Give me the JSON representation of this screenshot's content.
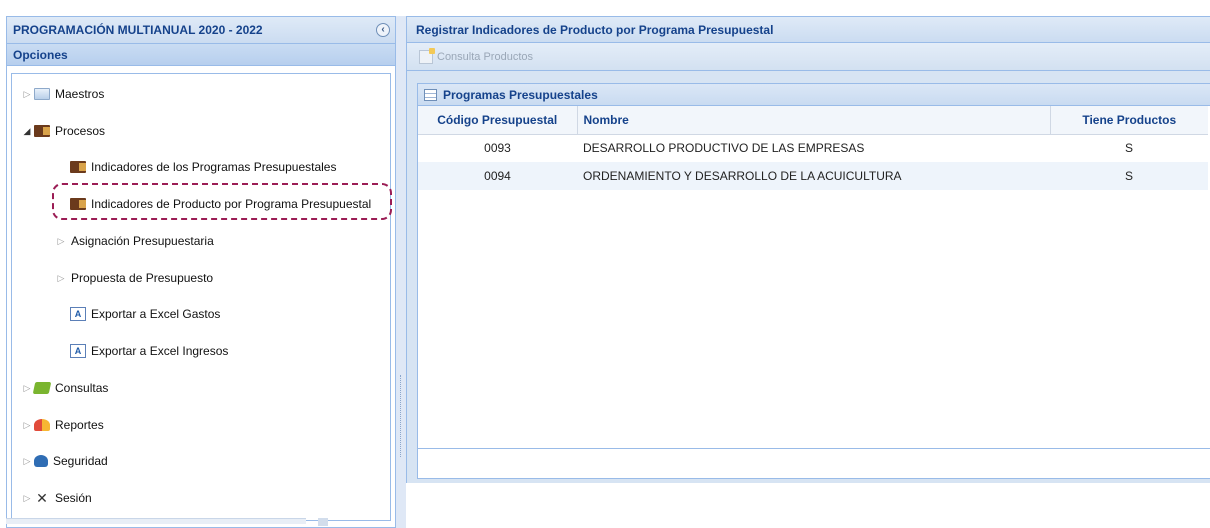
{
  "sidebar": {
    "title": "PROGRAMACIÓN MULTIANUAL 2020 - 2022",
    "collapse_icon": "chevron-left-icon",
    "options_label": "Opciones",
    "items": [
      {
        "label": "Maestros",
        "icon": "folder-icon"
      },
      {
        "label": "Procesos",
        "icon": "book-icon"
      },
      {
        "label": "Indicadores de los Programas Presupuestales",
        "icon": "book-icon"
      },
      {
        "label": "Indicadores de Producto por Programa Presupuestal",
        "icon": "book-icon"
      },
      {
        "label": "Asignación Presupuestaria"
      },
      {
        "label": "Propuesta de Presupuesto"
      },
      {
        "label": "Exportar a Excel Gastos",
        "icon": "excel-icon"
      },
      {
        "label": "Exportar a Excel Ingresos",
        "icon": "excel-icon"
      },
      {
        "label": "Consultas",
        "icon": "money-icon"
      },
      {
        "label": "Reportes",
        "icon": "chart-icon"
      },
      {
        "label": "Seguridad",
        "icon": "users-icon"
      },
      {
        "label": "Sesión",
        "icon": "tools-icon"
      }
    ]
  },
  "main": {
    "title": "Registrar Indicadores de Producto por Programa Presupuestal",
    "toolbar": {
      "consulta_label": "Consulta Productos"
    },
    "grid": {
      "title": "Programas Presupuestales",
      "columns": [
        "Código Presupuestal",
        "Nombre",
        "Tiene Productos"
      ],
      "rows": [
        [
          "0093",
          "DESARROLLO PRODUCTIVO DE LAS EMPRESAS",
          "S"
        ],
        [
          "0094",
          "ORDENAMIENTO Y DESARROLLO DE LA ACUICULTURA",
          "S"
        ]
      ]
    }
  },
  "colors": {
    "panel_border": "#99bbe8",
    "header_text": "#15428b",
    "highlight": "#9b1d55"
  }
}
